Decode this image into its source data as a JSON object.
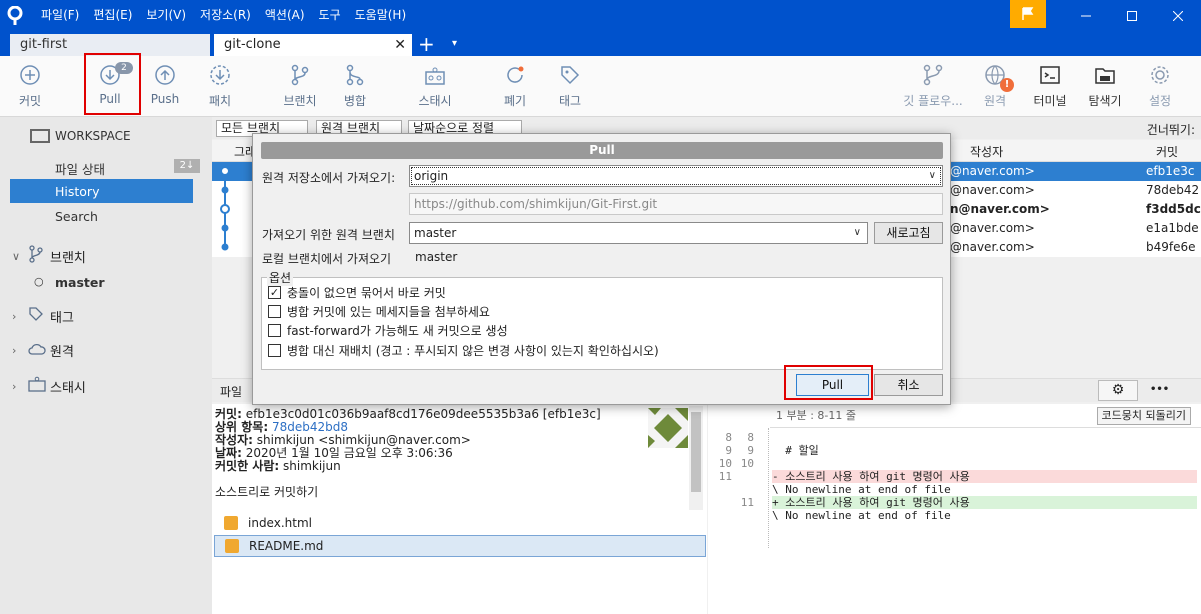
{
  "menu": [
    "파일(F)",
    "편집(E)",
    "보기(V)",
    "저장소(R)",
    "액션(A)",
    "도구",
    "도움말(H)"
  ],
  "tabs": {
    "inactive": "git-first",
    "active": "git-clone",
    "close": "✕",
    "add": "+",
    "more": "▾"
  },
  "toolbar": {
    "commit": "커밋",
    "pull": "Pull",
    "pull_badge": "2",
    "push": "Push",
    "fetch": "패치",
    "branch": "브랜치",
    "merge": "병합",
    "stash": "스태시",
    "discard": "폐기",
    "tag": "태그",
    "flow": "깃 플로우...",
    "remote": "원격",
    "terminal": "터미널",
    "explorer": "탐색기",
    "settings": "설정"
  },
  "sidebar": {
    "workspace": "WORKSPACE",
    "file_status": "파일 상태",
    "history": "History",
    "search": "Search",
    "branches": "브랜치",
    "master": "master",
    "master_count": "2↓",
    "tags": "태그",
    "remotes": "원격",
    "stashes": "스태시"
  },
  "filters": {
    "all_branches": "모든 브랜치",
    "remote_branch": "원격 브랜치",
    "sort": "날짜순으로 정렬",
    "skip": "건너뛰기:"
  },
  "columns": {
    "graph": "그래",
    "author": "작성자",
    "commit": "커밋"
  },
  "commits": [
    {
      "author": "@naver.com>",
      "hash": "efb1e3c",
      "bold": false
    },
    {
      "author": "@naver.com>",
      "hash": "78deb42",
      "bold": false
    },
    {
      "author": "n@naver.com>",
      "hash": "f3dd5dc",
      "bold": true
    },
    {
      "author": "@naver.com>",
      "hash": "e1a1bde",
      "bold": false
    },
    {
      "author": "@naver.com>",
      "hash": "b49fe6e",
      "bold": false
    }
  ],
  "lower": {
    "file_tab": "파일",
    "gear": "⚙",
    "ellipsis": "•••"
  },
  "detail": {
    "commit_label": "커밋:",
    "commit_value": "efb1e3c0d01c036b9aaf8cd176e09dee5535b3a6 [efb1e3c]",
    "parent_label": "상위 항목:",
    "parent_value": "78deb42bd8",
    "author_label": "작성자:",
    "author_value": "shimkijun <shimkijun@naver.com>",
    "date_label": "날짜:",
    "date_value": "2020년 1월 10일 금요일 오후 3:06:36",
    "committer_label": "커밋한 사람:",
    "committer_value": "shimkijun",
    "message": "소스트리로 커밋하기"
  },
  "files": [
    "index.html",
    "README.md"
  ],
  "diff": {
    "header": "1 부분 : 8-11 줄",
    "revert": "코드뭉치 되돌리기",
    "lines": [
      {
        "n1": "8",
        "n2": "8",
        "code": "",
        "type": "ctx"
      },
      {
        "n1": "9",
        "n2": "9",
        "code": "  # 할일",
        "type": "ctx"
      },
      {
        "n1": "10",
        "n2": "10",
        "code": "",
        "type": "ctx"
      },
      {
        "n1": "11",
        "n2": "",
        "code": "- 소스트리 사용 하여 git 명령어 사용",
        "type": "del"
      },
      {
        "n1": "",
        "n2": "",
        "code": "\\ No newline at end of file",
        "type": "ctx"
      },
      {
        "n1": "",
        "n2": "11",
        "code": "+ 소스트리 사용 하여 git 명령어 사용",
        "type": "add"
      },
      {
        "n1": "",
        "n2": "",
        "code": "\\ No newline at end of file",
        "type": "ctx"
      }
    ]
  },
  "dialog": {
    "title": "Pull",
    "remote_label": "원격 저장소에서 가져오기:",
    "remote_value": "origin",
    "url": "https://github.com/shimkijun/Git-First.git",
    "branch_label": "가져오기 위한 원격 브랜치",
    "branch_value": "master",
    "refresh": "새로고침",
    "local_label": "로컬 브랜치에서 가져오기",
    "local_value": "master",
    "options_legend": "옵션",
    "options": [
      {
        "label": "충돌이 없으면 묶어서 바로 커밋",
        "checked": true
      },
      {
        "label": "병합 커밋에 있는 메세지들을 첨부하세요",
        "checked": false
      },
      {
        "label": "fast-forward가 가능해도 새 커밋으로 생성",
        "checked": false
      },
      {
        "label": "병합 대신 재배치 (경고 : 푸시되지 않은 변경 사항이 있는지 확인하십시오)",
        "checked": false
      }
    ],
    "pull_button": "Pull",
    "cancel_button": "취소"
  },
  "colors": {
    "brand": "#0052cc",
    "selection": "#2d7fd0",
    "highlight": "#e00000"
  }
}
